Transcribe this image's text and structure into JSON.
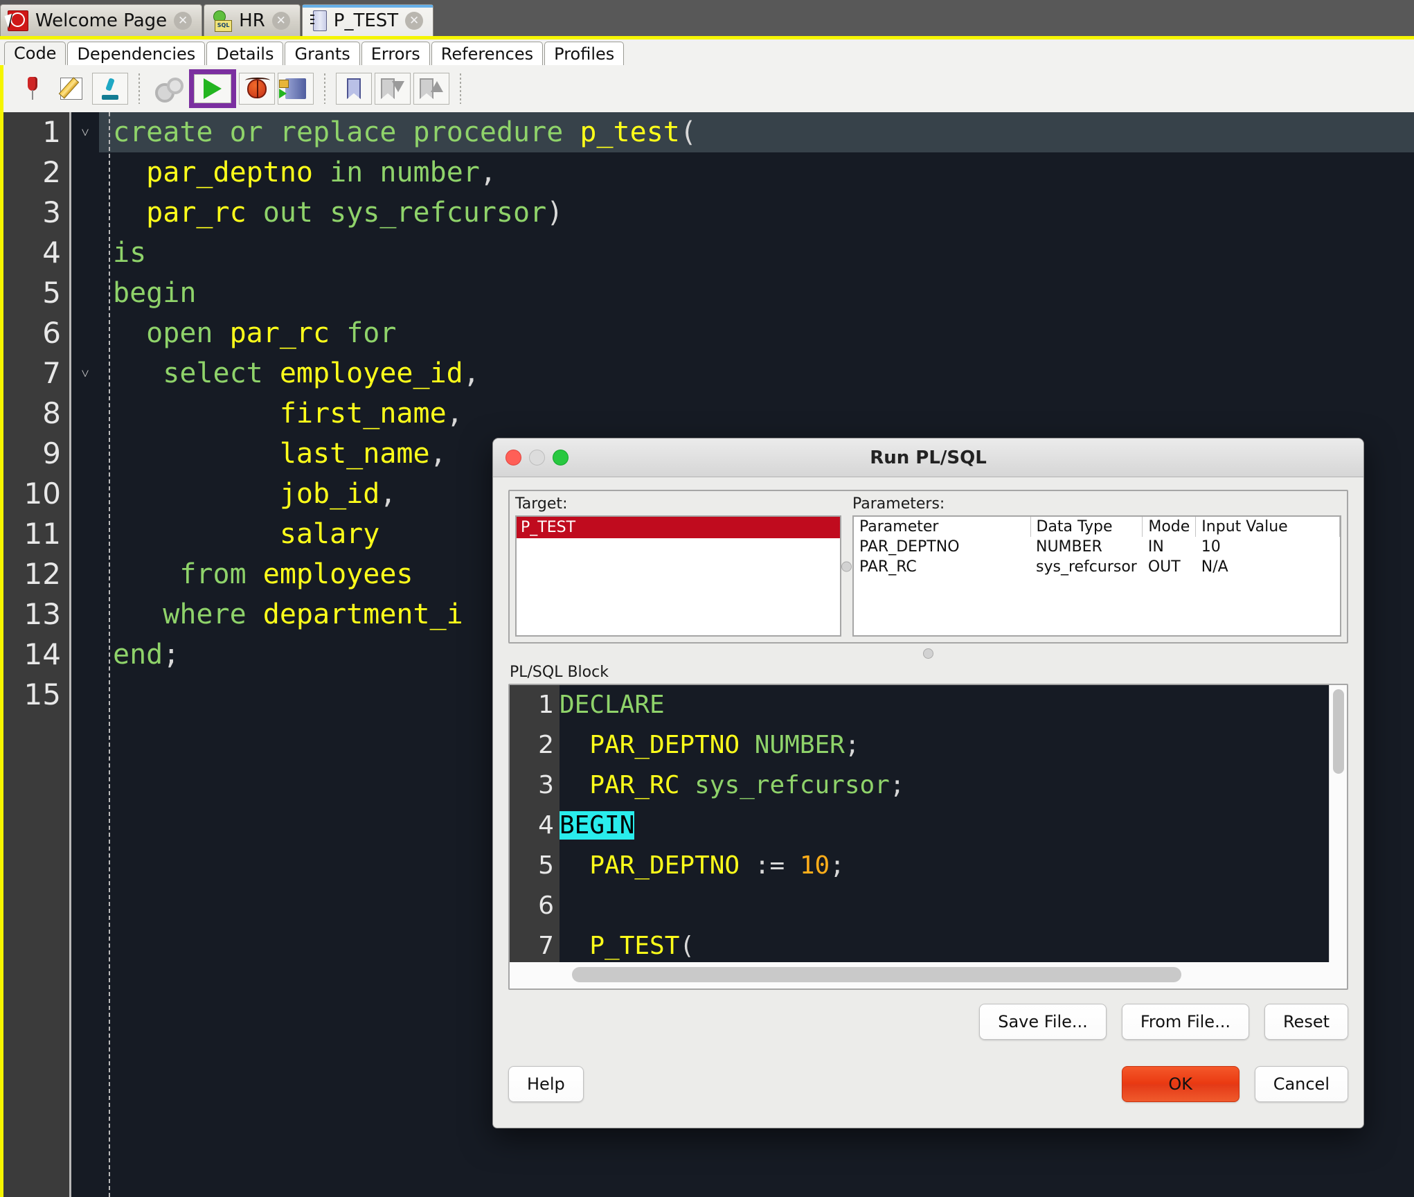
{
  "doc_tabs": [
    {
      "label": "Welcome Page",
      "icon": "welcome-page-icon",
      "close": "✕",
      "active": false
    },
    {
      "label": "HR",
      "icon": "database-connection-icon",
      "close": "✕",
      "active": false
    },
    {
      "label": "P_TEST",
      "icon": "procedure-icon",
      "close": "✕",
      "active": true
    }
  ],
  "sub_tabs": [
    {
      "label": "Code",
      "active": true
    },
    {
      "label": "Dependencies",
      "active": false
    },
    {
      "label": "Details",
      "active": false
    },
    {
      "label": "Grants",
      "active": false
    },
    {
      "label": "Errors",
      "active": false
    },
    {
      "label": "References",
      "active": false
    },
    {
      "label": "Profiles",
      "active": false
    }
  ],
  "toolbar": {
    "highlight_color": "#7b2fa0",
    "buttons": [
      {
        "name": "pin-icon"
      },
      {
        "name": "edit-icon"
      },
      {
        "name": "microscope-icon"
      },
      {
        "name": "compile-gears-icon"
      },
      {
        "name": "run-play-icon"
      },
      {
        "name": "debug-bug-icon"
      },
      {
        "name": "run-script-icon"
      },
      {
        "name": "bookmark-icon"
      },
      {
        "name": "bookmark-next-icon"
      },
      {
        "name": "bookmark-prev-icon"
      }
    ]
  },
  "editor": {
    "current_line": 1,
    "line_numbers": [
      "1",
      "2",
      "3",
      "4",
      "5",
      "6",
      "7",
      "8",
      "9",
      "10",
      "11",
      "12",
      "13",
      "14",
      "15"
    ],
    "fold_markers": {
      "1": "˅",
      "7": "˅"
    },
    "lines": [
      {
        "n": 1,
        "text": "create or replace procedure p_test("
      },
      {
        "n": 2,
        "text": "  par_deptno in number,"
      },
      {
        "n": 3,
        "text": "  par_rc out sys_refcursor)"
      },
      {
        "n": 4,
        "text": "is"
      },
      {
        "n": 5,
        "text": "begin"
      },
      {
        "n": 6,
        "text": "  open par_rc for"
      },
      {
        "n": 7,
        "text": "   select employee_id,"
      },
      {
        "n": 8,
        "text": "          first_name,"
      },
      {
        "n": 9,
        "text": "          last_name,"
      },
      {
        "n": 10,
        "text": "          job_id,"
      },
      {
        "n": 11,
        "text": "          salary"
      },
      {
        "n": 12,
        "text": "    from employees"
      },
      {
        "n": 13,
        "text": "   where department_i"
      },
      {
        "n": 14,
        "text": "end;"
      },
      {
        "n": 15,
        "text": ""
      }
    ],
    "colors": {
      "keyword": "#8fd36a",
      "identifier": "#ffff1a",
      "punct": "#d8d8d8",
      "background": "#161b24",
      "gutter": "#3b3b3b"
    }
  },
  "dialog": {
    "title": "Run PL/SQL",
    "target": {
      "label": "Target:",
      "items": [
        "P_TEST"
      ],
      "selected": "P_TEST",
      "selection_color": "#c00b1e"
    },
    "parameters": {
      "label": "Parameters:",
      "columns": [
        "Parameter",
        "Data Type",
        "Mode",
        "Input Value"
      ],
      "rows": [
        {
          "parameter": "PAR_DEPTNO",
          "data_type": "NUMBER",
          "mode": "IN",
          "input_value": "10"
        },
        {
          "parameter": "PAR_RC",
          "data_type": "sys_refcursor",
          "mode": "OUT",
          "input_value": "N/A"
        }
      ]
    },
    "plsql_block": {
      "label": "PL/SQL Block",
      "line_numbers": [
        "1",
        "2",
        "3",
        "4",
        "5",
        "6",
        "7"
      ],
      "lines": [
        {
          "n": 1,
          "text": "DECLARE"
        },
        {
          "n": 2,
          "text": "  PAR_DEPTNO NUMBER;"
        },
        {
          "n": 3,
          "text": "  PAR_RC sys_refcursor;"
        },
        {
          "n": 4,
          "text": "BEGIN"
        },
        {
          "n": 5,
          "text": "  PAR_DEPTNO := 10;"
        },
        {
          "n": 6,
          "text": ""
        },
        {
          "n": 7,
          "text": "  P_TEST("
        }
      ],
      "selection": {
        "line": 4,
        "text": "BEGIN",
        "background": "#29ecec",
        "foreground": "#000000"
      }
    },
    "file_buttons": [
      {
        "label": "Save File..."
      },
      {
        "label": "From File..."
      },
      {
        "label": "Reset"
      }
    ],
    "footer_buttons": [
      {
        "label": "Help",
        "primary": false
      },
      {
        "label": "OK",
        "primary": true
      },
      {
        "label": "Cancel",
        "primary": false
      }
    ]
  }
}
